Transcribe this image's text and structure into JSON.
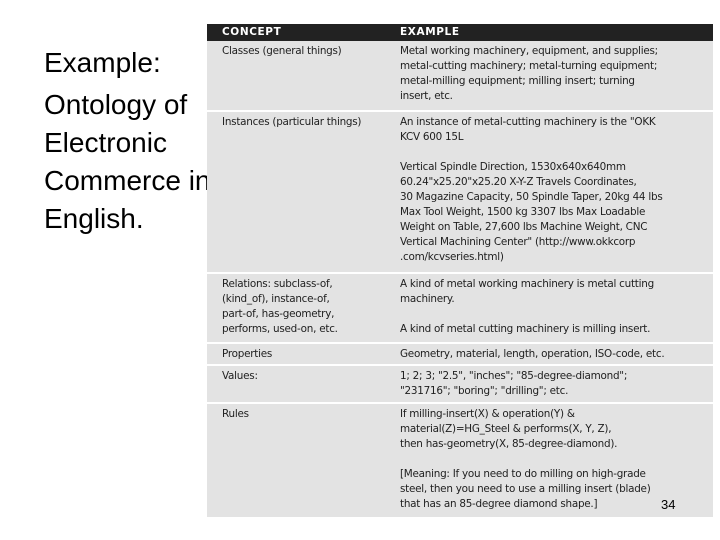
{
  "slide": {
    "title_line1": "Example:",
    "title_line2": "Ontology of Electronic Commerce in English.",
    "page_number": "34"
  },
  "table": {
    "headers": [
      "CONCEPT",
      "EXAMPLE"
    ],
    "rows": [
      {
        "concept": "Classes (general things)",
        "example": "Metal working machinery, equipment, and supplies;\nmetal-cutting machinery; metal-turning equipment;\nmetal-milling equipment; milling insert; turning\ninsert, etc."
      },
      {
        "concept": "Instances (particular things)",
        "example": "An instance of metal-cutting machinery is the \"OKK\nKCV 600 15L\n\nVertical Spindle Direction, 1530x640x640mm\n60.24\"x25.20\"x25.20 X-Y-Z Travels Coordinates,\n30 Magazine Capacity, 50 Spindle Taper, 20kg 44 lbs\nMax Tool Weight, 1500 kg 3307 lbs Max Loadable\nWeight on Table, 27,600 lbs Machine Weight, CNC\nVertical Machining Center\" (http://www.okkcorp\n.com/kcvseries.html)"
      },
      {
        "concept": "Relations: subclass-of,\n(kind_of), instance-of,\npart-of, has-geometry,\nperforms, used-on, etc.",
        "example": "A kind of metal working machinery is metal cutting\nmachinery.\n\nA kind of metal cutting machinery is milling insert."
      },
      {
        "concept": "Properties",
        "example": "Geometry, material, length, operation, ISO-code, etc."
      },
      {
        "concept": "Values:",
        "example": "1; 2; 3; \"2.5\", \"inches\"; \"85-degree-diamond\";\n\"231716\"; \"boring\"; \"drilling\"; etc."
      },
      {
        "concept": "Rules",
        "example": "If milling-insert(X) & operation(Y) &\nmaterial(Z)=HG_Steel & performs(X, Y, Z),\nthen has-geometry(X, 85-degree-diamond).\n\n[Meaning: If you need to do milling on high-grade\nsteel, then you need to use a milling insert (blade)\nthat has an 85-degree diamond shape.]"
      }
    ]
  }
}
